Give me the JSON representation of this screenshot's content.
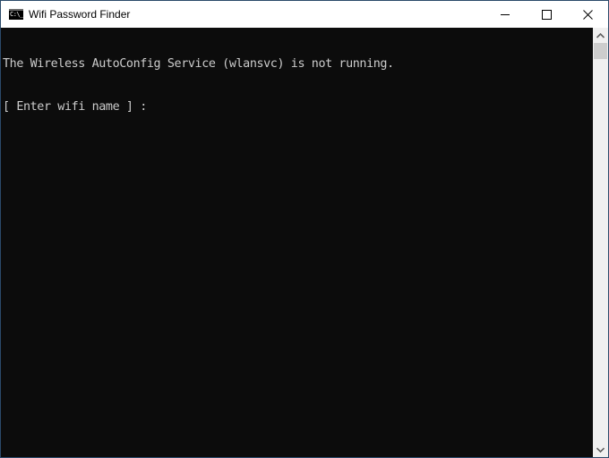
{
  "window": {
    "title": "Wifi Password Finder",
    "icon": "console-icon",
    "icon_text": "C:\\_",
    "controls": {
      "minimize": "minimize-icon",
      "maximize": "maximize-icon",
      "close": "close-icon"
    }
  },
  "console": {
    "lines": [
      "The Wireless AutoConfig Service (wlansvc) is not running.",
      "[ Enter wifi name ] : "
    ],
    "colors": {
      "background": "#0c0c0c",
      "foreground": "#cccccc"
    }
  },
  "scrollbar": {
    "up_icon": "chevron-up-icon",
    "down_icon": "chevron-down-icon",
    "position": 0
  }
}
